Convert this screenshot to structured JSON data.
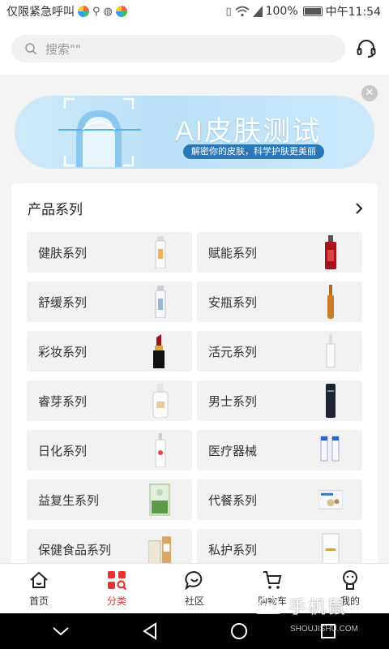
{
  "status_bar": {
    "left_text": "仅限紧急呼叫",
    "battery": "100%",
    "time": "中午11:54"
  },
  "search": {
    "placeholder": "搜索\"\""
  },
  "banner": {
    "title": "AI皮肤测试",
    "subtitle": "解密你的皮肤，科学护肤更美丽"
  },
  "products": {
    "title": "产品系列",
    "items": [
      {
        "label": "健肤系列",
        "icon": "white-bottle-icon"
      },
      {
        "label": "赋能系列",
        "icon": "red-bottle-icon"
      },
      {
        "label": "舒缓系列",
        "icon": "white-bottle-icon"
      },
      {
        "label": "安瓶系列",
        "icon": "ampoule-icon"
      },
      {
        "label": "彩妆系列",
        "icon": "lipstick-icon"
      },
      {
        "label": "活元系列",
        "icon": "white-bottle-icon"
      },
      {
        "label": "睿芽系列",
        "icon": "white-jar-icon"
      },
      {
        "label": "男士系列",
        "icon": "dark-bottle-icon"
      },
      {
        "label": "日化系列",
        "icon": "spray-bottle-icon"
      },
      {
        "label": "医疗器械",
        "icon": "tubes-icon"
      },
      {
        "label": "益复生系列",
        "icon": "green-box-icon"
      },
      {
        "label": "代餐系列",
        "icon": "food-box-icon"
      },
      {
        "label": "保健食品系列",
        "icon": "supplement-icon"
      },
      {
        "label": "私护系列",
        "icon": "white-box-icon"
      }
    ]
  },
  "nav": {
    "items": [
      {
        "label": "首页",
        "icon": "home-icon"
      },
      {
        "label": "分类",
        "icon": "category-icon"
      },
      {
        "label": "社区",
        "icon": "community-icon"
      },
      {
        "label": "购物车",
        "icon": "cart-icon"
      },
      {
        "label": "我的",
        "icon": "profile-icon"
      }
    ],
    "active_index": 1,
    "active_color": "#e8312f"
  },
  "watermark": {
    "main": "手机鼠",
    "sub": "SHOUJISHU.COM"
  }
}
